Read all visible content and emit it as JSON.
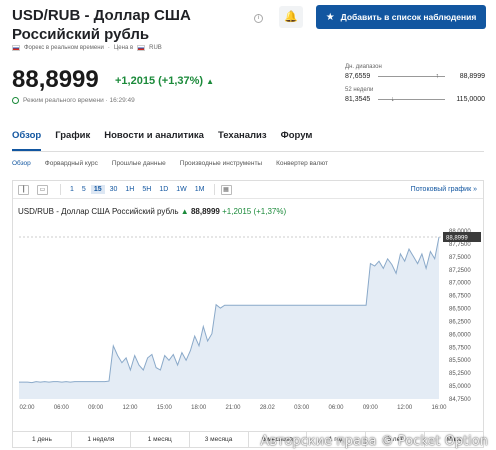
{
  "header": {
    "title": "USD/RUB - Доллар США Российский рубль",
    "watch_label": "Добавить в список наблюдения",
    "meta_source": "Форекс в реальном времени",
    "meta_currency_label": "Цена в",
    "meta_currency": "RUB"
  },
  "quote": {
    "price": "88,8999",
    "change": "+1,2015 (+1,37%)",
    "realtime": "Режим реального времени · 16:29:49"
  },
  "ranges": {
    "day_label": "Дн. диапазон",
    "day_low": "87,6559",
    "day_high": "88,8999",
    "week_label": "52 недели",
    "week_low": "81,3545",
    "week_high": "115,0000"
  },
  "tabs": [
    "Обзор",
    "График",
    "Новости и аналитика",
    "Теханализ",
    "Форум"
  ],
  "subnav": [
    "Обзор",
    "Форвардный курс",
    "Прошлые данные",
    "Производные инструменты",
    "Конвертер валют"
  ],
  "toolbar": {
    "timeframes": [
      "1",
      "5",
      "15",
      "30",
      "1H",
      "5H",
      "1D",
      "1W",
      "1M"
    ],
    "active_timeframe": "15",
    "advanced_link": "Потоковый график »"
  },
  "chart_header": {
    "name": "USD/RUB - Доллар США Российский рубль",
    "price": "88,8999",
    "change": "+1,2015 (+1,37%)"
  },
  "periods": [
    "1 день",
    "1 неделя",
    "1 месяц",
    "3 месяца",
    "6 месяцев",
    "1 год",
    "5 лет",
    "Макс"
  ],
  "watermark": "Авторские права © Pocket Option",
  "colors": {
    "accent": "#1256a0",
    "positive": "#1b8a3a",
    "line": "#8aa9c9",
    "fill": "#e4ecf5"
  },
  "chart_data": {
    "type": "area",
    "x_ticks": [
      "02:00",
      "06:00",
      "09:00",
      "12:00",
      "15:00",
      "18:00",
      "21:00",
      "28.02",
      "03:00",
      "06:00",
      "09:00",
      "12:00",
      "16:00"
    ],
    "y_ticks": [
      "88,0000",
      "87,7500",
      "87,5000",
      "87,2500",
      "87,0000",
      "86,7500",
      "86,5000",
      "86,2500",
      "86,0000",
      "85,7500",
      "85,5000",
      "85,2500",
      "85,0000",
      "84,7500"
    ],
    "ylim": [
      84.7,
      88.05
    ],
    "last_label": "88,8999",
    "values": [
      85.05,
      85.05,
      85.05,
      85.04,
      85.06,
      85.05,
      85.06,
      85.05,
      85.06,
      85.06,
      85.05,
      85.06,
      85.05,
      85.06,
      85.06,
      85.06,
      85.06,
      85.06,
      85.06,
      85.06,
      85.06,
      85.07,
      85.8,
      85.6,
      85.45,
      85.55,
      85.3,
      85.6,
      85.4,
      85.3,
      85.55,
      85.62,
      85.35,
      85.3,
      85.6,
      85.5,
      85.62,
      85.4,
      85.66,
      85.5,
      85.7,
      86.0,
      85.8,
      86.2,
      85.9,
      86.05,
      86.65,
      86.58,
      86.64,
      86.64,
      86.64,
      86.64,
      86.64,
      86.64,
      86.64,
      86.64,
      86.64,
      86.64,
      86.64,
      86.64,
      86.64,
      86.64,
      86.64,
      86.64,
      86.64,
      86.64,
      86.64,
      86.64,
      86.64,
      86.64,
      86.64,
      86.64,
      86.64,
      86.64,
      86.64,
      86.64,
      86.64,
      86.64,
      86.64,
      86.64,
      86.64,
      86.64,
      87.5,
      87.45,
      87.55,
      87.4,
      87.6,
      87.48,
      87.3,
      87.7,
      87.55,
      87.8,
      87.65,
      87.5,
      87.7,
      87.4,
      87.75,
      87.6,
      88.05
    ]
  }
}
